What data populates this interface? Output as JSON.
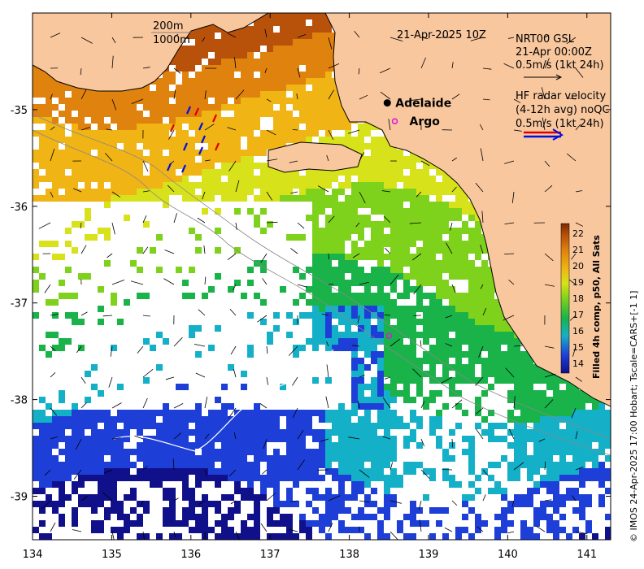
{
  "map": {
    "timestamp": "21-Apr-2025 10Z",
    "depth_labels": [
      "200m",
      "1000m"
    ],
    "places": [
      {
        "name": "Adelaide",
        "lon": 138.5,
        "lat": -34.93
      },
      {
        "name": "Argo",
        "lon": 138.8,
        "lat": -35.12
      }
    ],
    "argo_extra": {
      "lon": 138.5,
      "lat": -37.34
    },
    "legend_gsl": [
      "NRT00 GSL",
      "21-Apr 00:00Z",
      "0.5m/s (1kt 24h)"
    ],
    "legend_hf": [
      "HF radar velocity",
      "(4-12h avg) noQC",
      "0.5m/s (1kt 24h)"
    ],
    "x_ticks": [
      "134",
      "135",
      "136",
      "137",
      "138",
      "139",
      "140",
      "141"
    ],
    "y_ticks": [
      "-35",
      "-36",
      "-37",
      "-38",
      "-39"
    ],
    "lon_range": [
      134,
      141.3
    ],
    "lat_range": [
      -39.45,
      -34.0
    ],
    "colorbar": {
      "label": "Filled 4h comp, p50, All Sats",
      "ticks": [
        "22",
        "21",
        "20",
        "19",
        "18",
        "17",
        "16",
        "15",
        "14"
      ],
      "range": [
        13.4,
        22.6
      ]
    },
    "credit": "© IMOS 24-Apr-2025 17:00 Hobart; Tscale=CARS+[-1 1]",
    "colors": {
      "land": "#f9c79e",
      "coast": "#000000",
      "frame": "#000000"
    }
  }
}
